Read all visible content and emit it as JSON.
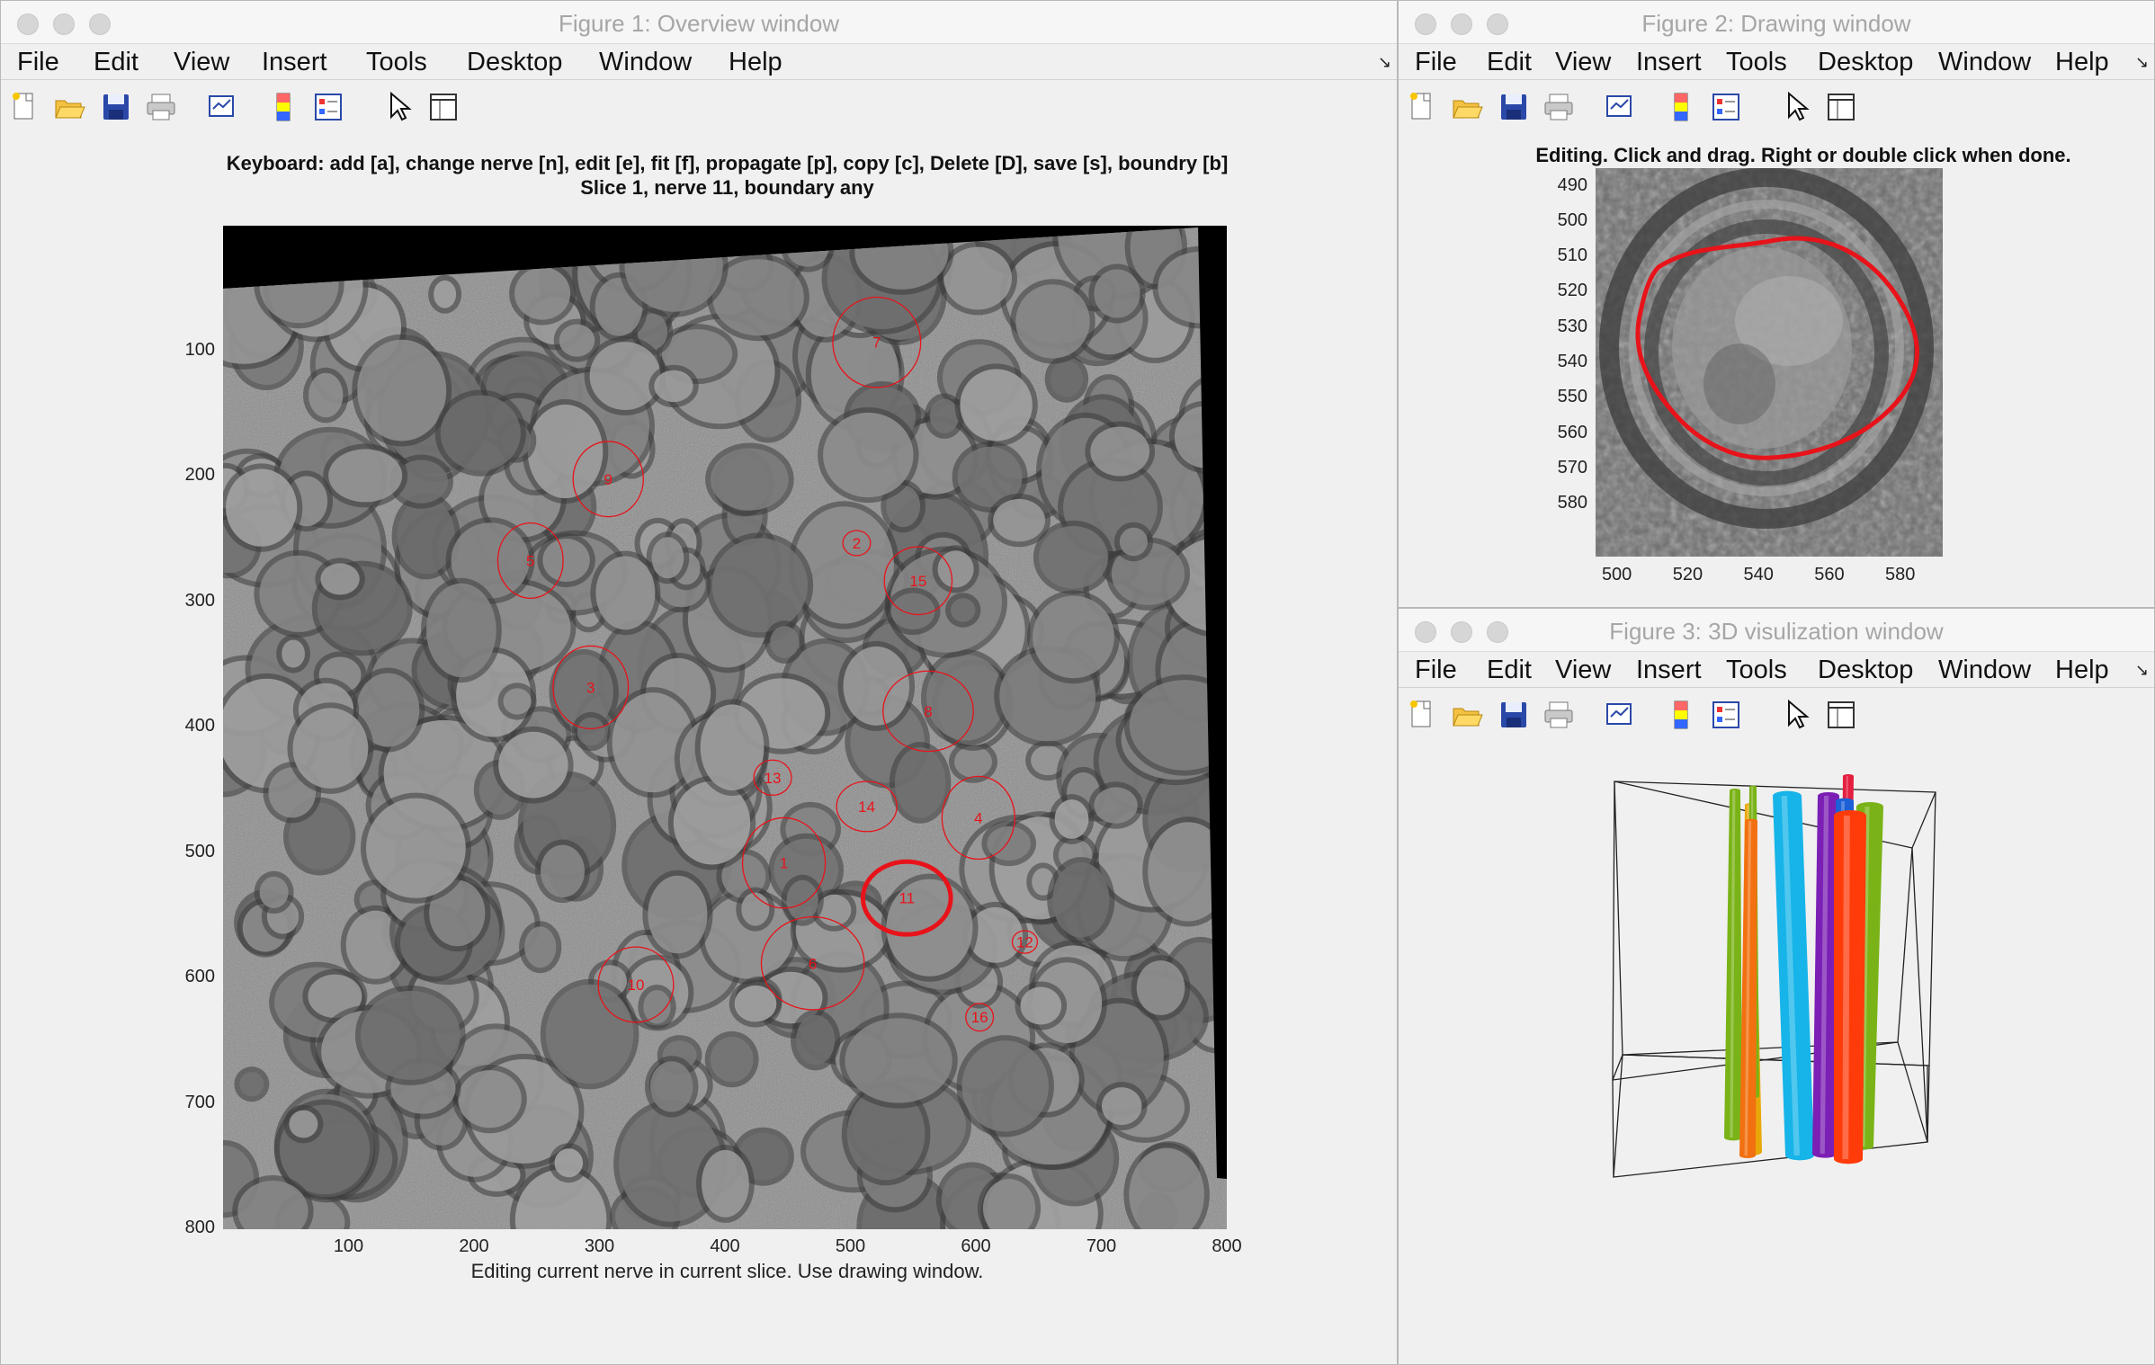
{
  "menu_labels": [
    "File",
    "Edit",
    "View",
    "Insert",
    "Tools",
    "Desktop",
    "Window",
    "Help"
  ],
  "fig1": {
    "title": "Figure 1: Overview window",
    "instructions": "Keyboard: add [a], change nerve [n], edit [e], fit [f], propagate [p], copy [c], Delete [D], save [s], boundry [b]",
    "subtitle": "Slice 1, nerve 11, boundary any",
    "status": "Editing current nerve in current slice. Use drawing window.",
    "xticks": [
      "100",
      "200",
      "300",
      "400",
      "500",
      "600",
      "700",
      "800"
    ],
    "yticks": [
      "100",
      "200",
      "300",
      "400",
      "500",
      "600",
      "700",
      "800"
    ],
    "current_nerve": "11",
    "nerves": [
      {
        "id": "7",
        "x": 521,
        "y": 93
      },
      {
        "id": "9",
        "x": 307,
        "y": 202
      },
      {
        "id": "5",
        "x": 245,
        "y": 267
      },
      {
        "id": "2",
        "x": 505,
        "y": 253
      },
      {
        "id": "15",
        "x": 554,
        "y": 283
      },
      {
        "id": "3",
        "x": 293,
        "y": 368
      },
      {
        "id": "8",
        "x": 562,
        "y": 387
      },
      {
        "id": "13",
        "x": 438,
        "y": 440
      },
      {
        "id": "14",
        "x": 513,
        "y": 463
      },
      {
        "id": "4",
        "x": 602,
        "y": 472
      },
      {
        "id": "1",
        "x": 447,
        "y": 508
      },
      {
        "id": "11",
        "x": 545,
        "y": 536
      },
      {
        "id": "12",
        "x": 639,
        "y": 571
      },
      {
        "id": "6",
        "x": 470,
        "y": 588
      },
      {
        "id": "10",
        "x": 329,
        "y": 605
      },
      {
        "id": "16",
        "x": 603,
        "y": 631
      }
    ]
  },
  "fig2": {
    "title": "Figure 2: Drawing window",
    "instructions": "Editing. Click and drag. Right or double click when done.",
    "xticks": [
      "500",
      "520",
      "540",
      "560",
      "580"
    ],
    "yticks": [
      "490",
      "500",
      "510",
      "520",
      "530",
      "540",
      "550",
      "560",
      "570",
      "580"
    ]
  },
  "fig3": {
    "title": "Figure 3: 3D visulization window"
  },
  "colors": {
    "contour": "#e8131a",
    "tubes": [
      "#7ab317",
      "#e8a80a",
      "#f27010",
      "#ff3b0a",
      "#16b4e8",
      "#7b1fb5",
      "#e41e3f",
      "#1c5fd6"
    ]
  }
}
